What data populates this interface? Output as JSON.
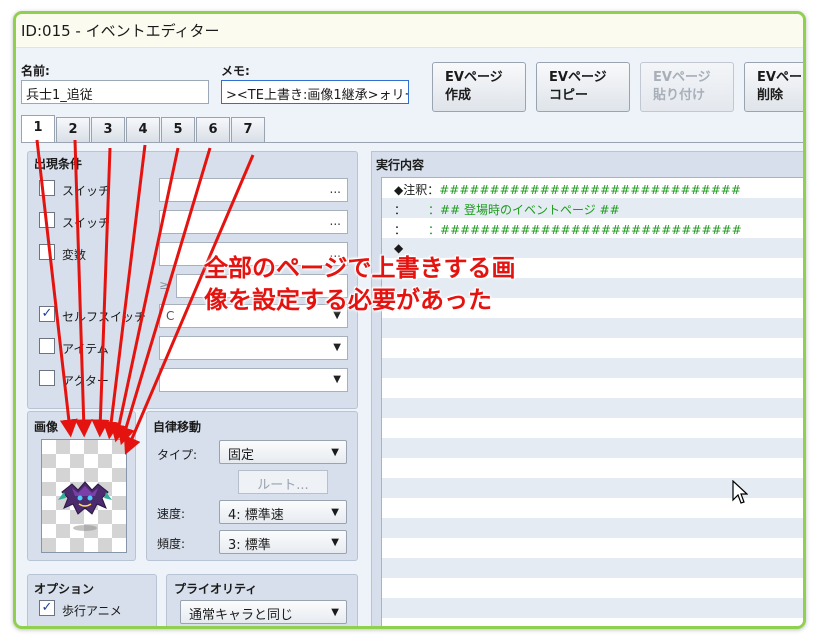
{
  "window": {
    "title": "ID:015 - イベントエディター"
  },
  "header": {
    "name_label": "名前:",
    "name_value": "兵士1_追従",
    "memo_label": "メモ:",
    "memo_value": "><TE上書き:画像1継承>ォリー"
  },
  "toolbar": {
    "new_page": "EVページ\n作成",
    "copy_page": "EVページ\nコピー",
    "paste_page": "EVページ\n貼り付け",
    "delete_page": "EVペー\n削除"
  },
  "tabs": [
    "1",
    "2",
    "3",
    "4",
    "5",
    "6",
    "7"
  ],
  "conditions": {
    "title": "出現条件",
    "switch1": "スイッチ",
    "switch2": "スイッチ",
    "variable": "変数",
    "ge_symbol": "≥",
    "self_switch": "セルフスイッチ",
    "self_switch_value": "C",
    "item": "アイテム",
    "actor": "アクター",
    "dots": "..."
  },
  "image": {
    "title": "画像"
  },
  "autonomous": {
    "title": "自律移動",
    "type_label": "タイプ:",
    "type_value": "固定",
    "route_label": "ルート...",
    "speed_label": "速度:",
    "speed_value": "4: 標準速",
    "freq_label": "頻度:",
    "freq_value": "3: 標準"
  },
  "options": {
    "title": "オプション",
    "walk_anim": "歩行アニメ"
  },
  "priority": {
    "title": "プライオリティ",
    "value": "通常キャラと同じ"
  },
  "contents": {
    "title": "実行内容",
    "lines": [
      {
        "prefix": "◆注釈：",
        "text": "##############################"
      },
      {
        "prefix": "：",
        "text": "：## 登場時のイベントページ ##"
      },
      {
        "prefix": "：",
        "text": "：##############################"
      },
      {
        "prefix": "◆",
        "text": ""
      }
    ]
  },
  "annotation": {
    "text": "全部のページで上書きする画像を設定する必要があった",
    "color": "#e5130f"
  },
  "colors": {
    "window_border": "#8fd14f",
    "accent_green": "#1e9b1e"
  }
}
